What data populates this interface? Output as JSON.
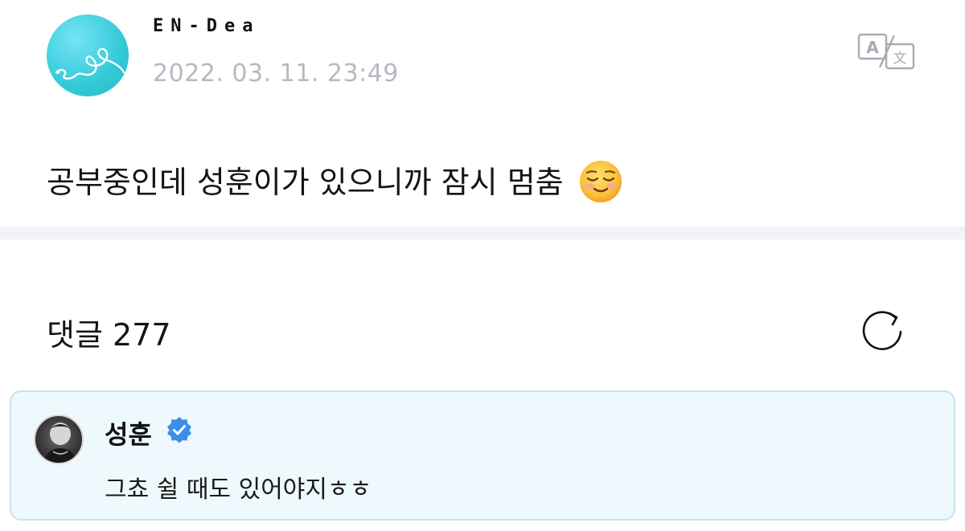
{
  "post": {
    "author": "EN-Dea",
    "timestamp": "2022. 03. 11. 23:49",
    "body": "공부중인데 성훈이가 있으니까 잠시 멈춤",
    "emoji": "smiling-face-icon",
    "translate_icon": "translate-icon"
  },
  "comments": {
    "title": "댓글 277",
    "refresh_icon": "refresh-icon",
    "pinned": {
      "author": "성훈",
      "verified": true,
      "text": "그쵸 쉴 때도 있어야지ㅎㅎ"
    }
  },
  "colors": {
    "avatar_teal": "#34c9d8",
    "timestamp_gray": "#b5b9c0",
    "divider": "#f2f3f6",
    "card_bg": "#eef9fd",
    "card_border": "#c5e4ee",
    "verified_blue": "#3b8fe8"
  }
}
